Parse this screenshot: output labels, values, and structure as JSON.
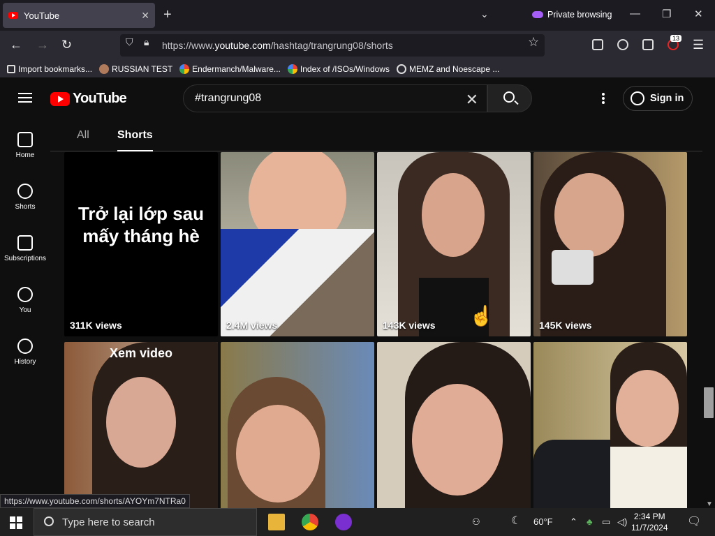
{
  "browser": {
    "tab_title": "YouTube",
    "tab_close": "✕",
    "new_tab": "+",
    "private_label": "Private browsing",
    "url_prefix": "https://www.",
    "url_host": "youtube.com",
    "url_path": "/hashtag/trangrung08/shorts",
    "extension_badge": "13",
    "bookmarks": [
      {
        "label": "Import bookmarks...",
        "icon": "import-icon"
      },
      {
        "label": "RUSSIAN TEST",
        "icon": "site-icon"
      },
      {
        "label": "Endermanch/Malware...",
        "icon": "google-icon"
      },
      {
        "label": "Index of /ISOs/Windows",
        "icon": "google-icon"
      },
      {
        "label": "MEMZ and Noescape ...",
        "icon": "globe-icon"
      }
    ]
  },
  "youtube": {
    "logo_text": "YouTube",
    "search_value": "#trangrung08",
    "signin_label": "Sign in",
    "nav": [
      {
        "label": "Home",
        "icon": "home-icon"
      },
      {
        "label": "Shorts",
        "icon": "shorts-icon"
      },
      {
        "label": "Subscriptions",
        "icon": "subscriptions-icon"
      },
      {
        "label": "You",
        "icon": "you-icon"
      },
      {
        "label": "History",
        "icon": "history-icon"
      }
    ],
    "filters": {
      "all": "All",
      "shorts": "Shorts"
    },
    "shorts": [
      {
        "views": "311K views",
        "overlay_line1": "Trở lại lớp sau",
        "overlay_line2": "mấy tháng hè"
      },
      {
        "views": "2.4M views"
      },
      {
        "views": "143K views"
      },
      {
        "views": "145K views"
      },
      {
        "overlay": "Xem video"
      },
      {},
      {},
      {}
    ],
    "status_url": "https://www.youtube.com/shorts/AYOYm7NTRa0"
  },
  "taskbar": {
    "search_placeholder": "Type here to search",
    "weather": "60°F",
    "time": "2:34 PM",
    "date": "11/7/2024"
  },
  "colors": {
    "accent": "#ff0000",
    "private": "#a45df5",
    "background": "#0f0f0f"
  }
}
